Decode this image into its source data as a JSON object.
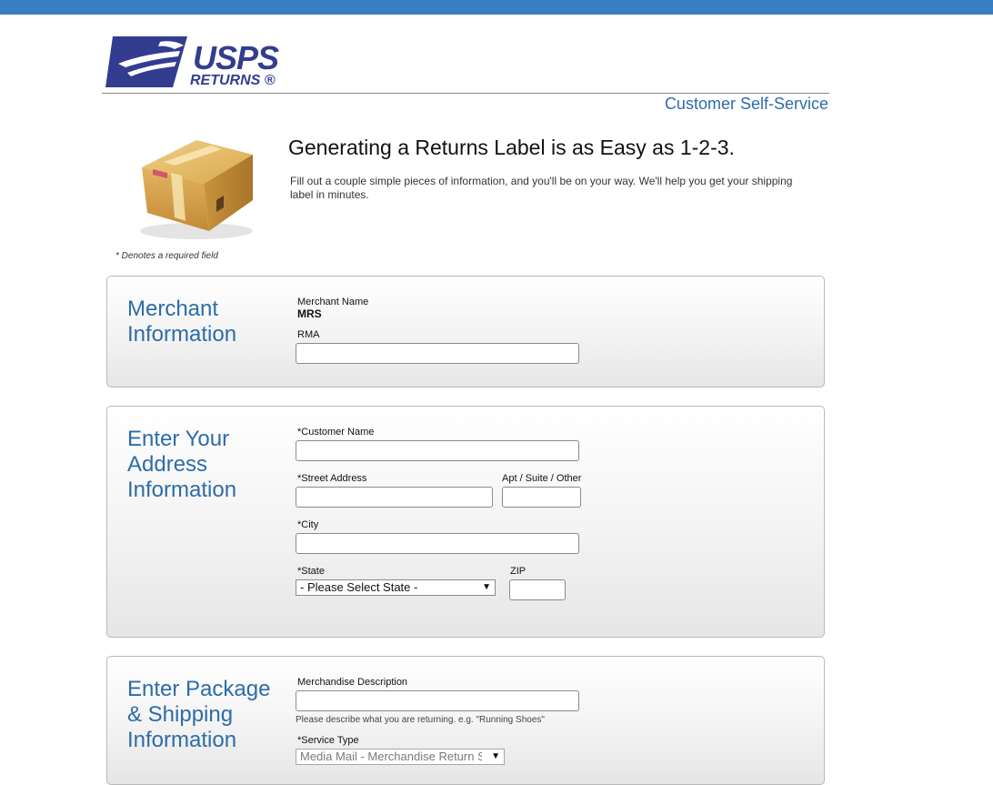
{
  "header": {
    "logo_usps": "USPS",
    "logo_returns": "RETURNS ®",
    "self_service": "Customer Self-Service"
  },
  "intro": {
    "title": "Generating a Returns Label is as Easy as 1-2-3.",
    "text": "Fill out a couple simple pieces of information, and you'll be on your way. We'll help you get your shipping label in minutes.",
    "required_note": "* Denotes a required field"
  },
  "merchant": {
    "title": "Merchant Information",
    "merchant_name_label": "Merchant Name",
    "merchant_name_value": "MRS",
    "rma_label": "RMA",
    "rma_value": ""
  },
  "address": {
    "title": "Enter Your Address Information",
    "customer_name_label": "*Customer Name",
    "street_label": "*Street Address",
    "apt_label": "Apt / Suite / Other",
    "city_label": "*City",
    "state_label": "*State",
    "state_selected": "- Please Select State -",
    "zip_label": "ZIP"
  },
  "package": {
    "title": "Enter Package & Shipping Information",
    "description_label": "Merchandise Description",
    "description_help": "Please describe what you are returning. e.g. \"Running Shoes\"",
    "service_label": "*Service Type",
    "service_selected": "Media Mail - Merchandise Return Service"
  },
  "colors": {
    "topbar": "#3a7fc4",
    "brand_navy": "#333d8f",
    "heading_blue": "#2d6ca8"
  },
  "icons": {
    "logo": "usps-eagle-logo",
    "illustration": "package-box-icon",
    "dropdown": "chevron-down-icon"
  }
}
